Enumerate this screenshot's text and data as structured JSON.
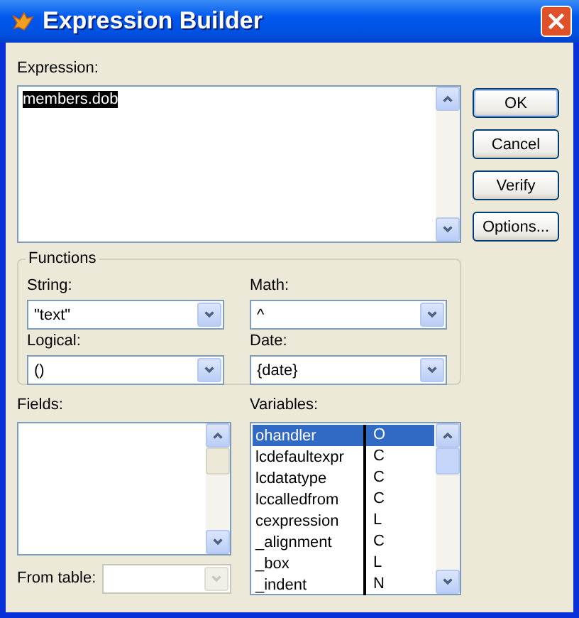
{
  "window": {
    "title": "Expression Builder"
  },
  "expression": {
    "label": "Expression:",
    "value": "members.dob",
    "selected": true
  },
  "buttons": [
    {
      "label": "OK",
      "default": true
    },
    {
      "label": "Cancel",
      "default": false
    },
    {
      "label": "Verify",
      "default": false
    },
    {
      "label": "Options...",
      "default": false
    }
  ],
  "functions": {
    "title": "Functions",
    "combos": [
      {
        "label": "String:",
        "value": "\"text\""
      },
      {
        "label": "Math:",
        "value": "^"
      },
      {
        "label": "Logical:",
        "value": "()"
      },
      {
        "label": "Date:",
        "value": "{date}"
      }
    ]
  },
  "fields": {
    "label": "Fields:"
  },
  "from_table": {
    "label": "From table:",
    "disabled": true
  },
  "variables": {
    "label": "Variables:",
    "rows": [
      {
        "name": "ohandler",
        "type": "O",
        "selected": true
      },
      {
        "name": "lcdefaultexpr",
        "type": "C",
        "selected": false
      },
      {
        "name": "lcdatatype",
        "type": "C",
        "selected": false
      },
      {
        "name": "lccalledfrom",
        "type": "C",
        "selected": false
      },
      {
        "name": "cexpression",
        "type": "L",
        "selected": false
      },
      {
        "name": "_alignment",
        "type": "C",
        "selected": false
      },
      {
        "name": "_box",
        "type": "L",
        "selected": false
      },
      {
        "name": "_indent",
        "type": "N",
        "selected": false
      }
    ]
  }
}
